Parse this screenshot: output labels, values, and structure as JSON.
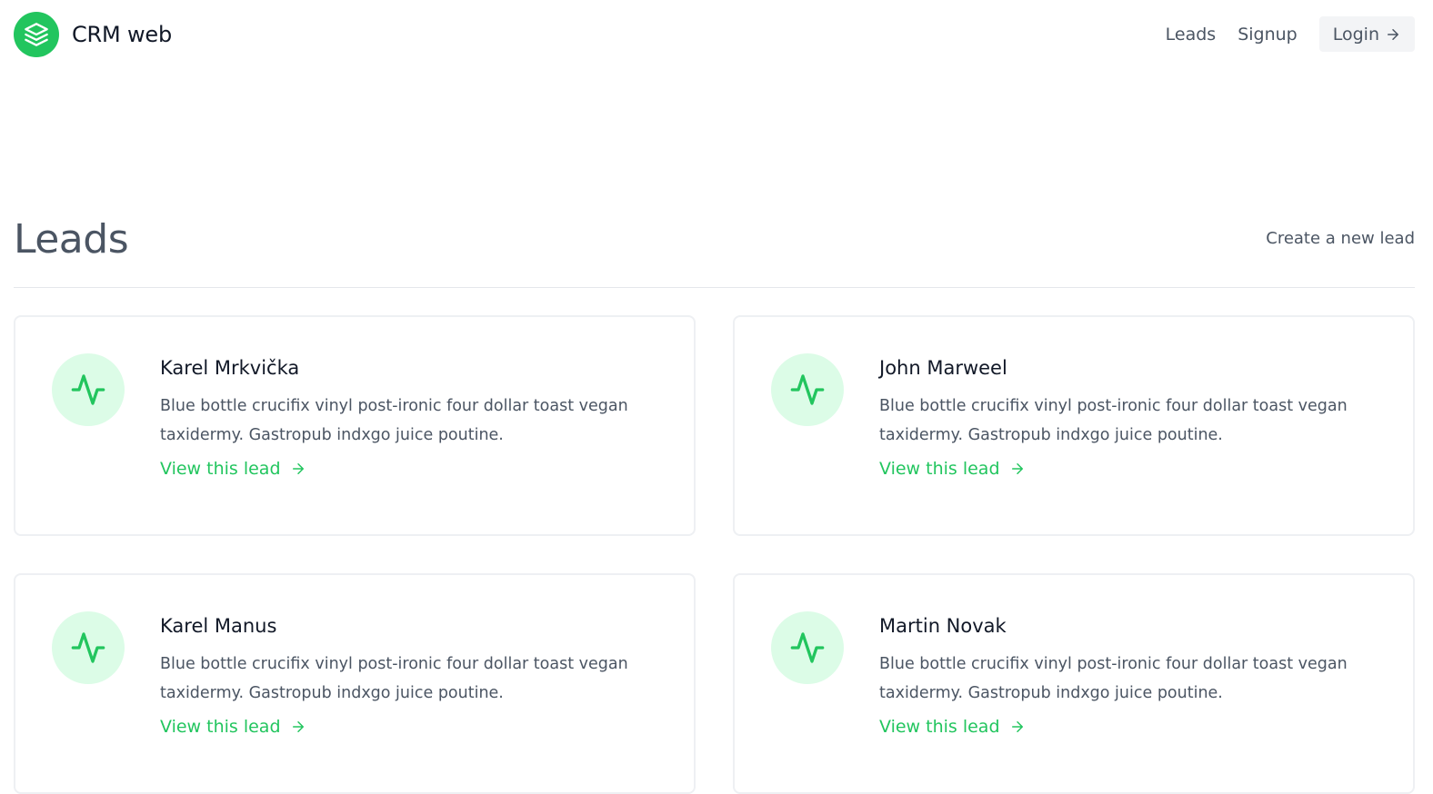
{
  "header": {
    "brand_name": "CRM web",
    "nav": {
      "leads": "Leads",
      "signup": "Signup",
      "login": "Login"
    }
  },
  "page": {
    "title": "Leads",
    "create_link": "Create a new lead"
  },
  "leads": [
    {
      "name": "Karel Mrkvička",
      "description": "Blue bottle crucifix vinyl post-ironic four dollar toast vegan taxidermy. Gastropub indxgo juice poutine.",
      "link": "View this lead"
    },
    {
      "name": "John Marweel",
      "description": "Blue bottle crucifix vinyl post-ironic four dollar toast vegan taxidermy. Gastropub indxgo juice poutine.",
      "link": "View this lead"
    },
    {
      "name": "Karel Manus",
      "description": "Blue bottle crucifix vinyl post-ironic four dollar toast vegan taxidermy. Gastropub indxgo juice poutine.",
      "link": "View this lead"
    },
    {
      "name": "Martin Novak",
      "description": "Blue bottle crucifix vinyl post-ironic four dollar toast vegan taxidermy. Gastropub indxgo juice poutine.",
      "link": "View this lead"
    }
  ],
  "icons": {
    "brand": "stacked-layers-icon",
    "lead": "activity-pulse-icon",
    "arrow": "arrow-right-icon"
  },
  "colors": {
    "accent": "#22c55e",
    "accent_light": "#dcfce7",
    "text": "#4b5563",
    "heading": "#111827"
  }
}
